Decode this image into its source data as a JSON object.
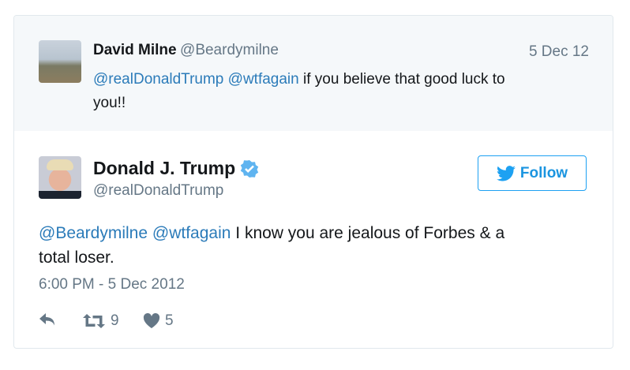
{
  "parent_tweet": {
    "name": "David Milne",
    "handle": "@Beardymilne",
    "date": "5 Dec 12",
    "mention1": "@realDonaldTrump",
    "mention2": "@wtfagain",
    "text_line1": " if you believe that good luck to",
    "text_line2": "you!!"
  },
  "tweet": {
    "name": "Donald J. Trump",
    "verified": true,
    "handle": "@realDonaldTrump",
    "follow_label": "Follow",
    "mention1": "@Beardymilne",
    "mention2": "@wtfagain",
    "text_line1": " I know you are jealous of Forbes & a",
    "text_line2": "total loser.",
    "timestamp": "6:00 PM - 5 Dec 2012",
    "retweets": "9",
    "likes": "5"
  },
  "colors": {
    "link": "#2b7bb9",
    "accent": "#1da1f2",
    "muted": "#657786"
  }
}
